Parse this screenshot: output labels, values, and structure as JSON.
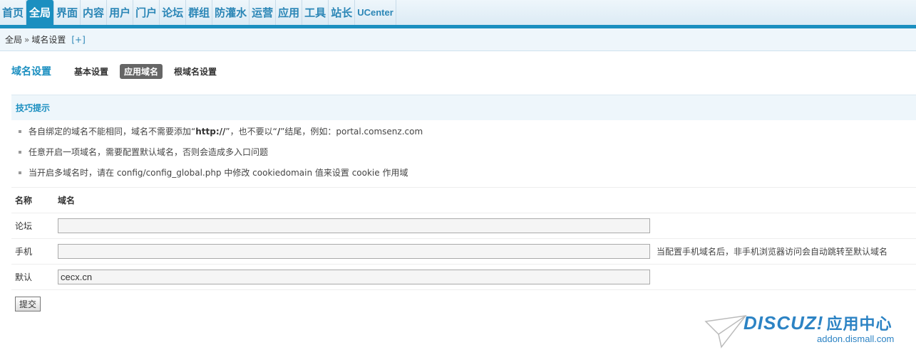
{
  "nav": {
    "items": [
      "首页",
      "全局",
      "界面",
      "内容",
      "用户",
      "门户",
      "论坛",
      "群组",
      "防灌水",
      "运营",
      "应用",
      "工具",
      "站长",
      "UCenter"
    ],
    "active_index": 1
  },
  "breadcrumb": {
    "root": "全局",
    "sep": "»",
    "current": "域名设置",
    "add": "[+]"
  },
  "subnav": {
    "title": "域名设置",
    "tabs": [
      "基本设置",
      "应用域名",
      "根域名设置"
    ],
    "active_index": 1
  },
  "tips": {
    "title": "技巧提示",
    "line1_pre": "各自绑定的域名不能相同，域名不需要添加“",
    "line1_bold": "http://",
    "line1_mid": "”，也不要以“",
    "line1_bold2": "/",
    "line1_post": "”结尾，例如：portal.comsenz.com",
    "line2": "任意开启一项域名，需要配置默认域名，否则会造成多入口问题",
    "line3": "当开启多域名时，请在 config/config_global.php 中修改 cookiedomain 值来设置 cookie 作用域"
  },
  "table": {
    "header_name": "名称",
    "header_domain": "域名",
    "rows": [
      {
        "name": "论坛",
        "value": "",
        "note": ""
      },
      {
        "name": "手机",
        "value": "",
        "note": "当配置手机域名后，非手机浏览器访问会自动跳转至默认域名"
      },
      {
        "name": "默认",
        "value": "cecx.cn",
        "note": ""
      }
    ]
  },
  "submit_label": "提交",
  "watermark": {
    "brand": "DISCUZ!",
    "brand_cn": "应用中心",
    "url": "addon.dismall.com"
  },
  "colors": {
    "accent": "#1b8fc0",
    "nav_bg": "#eef6fb",
    "brand_blue": "#2c83c4"
  }
}
